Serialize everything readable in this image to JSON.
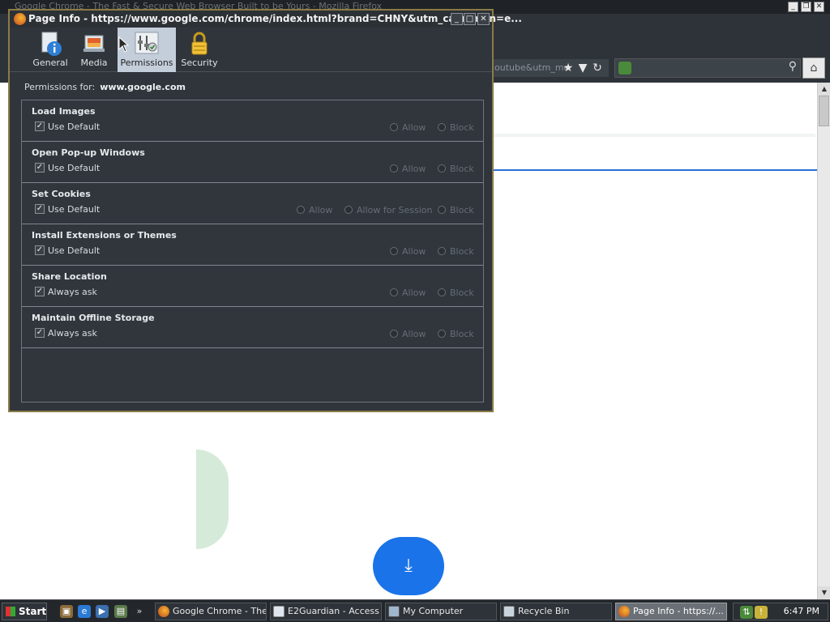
{
  "browser": {
    "title": "Google Chrome - The Fast & Secure Web Browser Built to be Yours - Mozilla Firefox",
    "url_fragment": "outube&utm_me"
  },
  "dialog": {
    "title": "Page Info - https://www.google.com/chrome/index.html?brand=CHNY&utm_campaign=e...",
    "tabs": [
      {
        "label": "General",
        "icon": "info-icon"
      },
      {
        "label": "Media",
        "icon": "media-icon"
      },
      {
        "label": "Permissions",
        "icon": "permissions-icon",
        "selected": true
      },
      {
        "label": "Security",
        "icon": "lock-icon"
      }
    ],
    "permissions_for_label": "Permissions for:",
    "permissions_for_site": "www.google.com",
    "permissions": [
      {
        "title": "Load Images",
        "default_label": "Use Default",
        "options": [
          "Allow",
          "Block"
        ]
      },
      {
        "title": "Open Pop-up Windows",
        "default_label": "Use Default",
        "options": [
          "Allow",
          "Block"
        ]
      },
      {
        "title": "Set Cookies",
        "default_label": "Use Default",
        "options": [
          "Allow",
          "Allow for Session",
          "Block"
        ]
      },
      {
        "title": "Install Extensions or Themes",
        "default_label": "Use Default",
        "options": [
          "Allow",
          "Block"
        ]
      },
      {
        "title": "Share Location",
        "default_label": "Always ask",
        "options": [
          "Allow",
          "Block"
        ]
      },
      {
        "title": "Maintain Offline Storage",
        "default_label": "Always ask",
        "options": [
          "Allow",
          "Block"
        ]
      }
    ]
  },
  "taskbar": {
    "start_label": "Start",
    "tasks": [
      {
        "label": "Google Chrome - The...",
        "icon": "firefox-icon"
      },
      {
        "label": "E2Guardian - Access ...",
        "icon": "document-icon"
      },
      {
        "label": "My Computer",
        "icon": "computer-icon"
      },
      {
        "label": "Recycle Bin",
        "icon": "recycle-bin-icon"
      },
      {
        "label": "Page Info - https://...",
        "icon": "firefox-icon",
        "active": true
      }
    ],
    "clock": "6:47 PM"
  }
}
